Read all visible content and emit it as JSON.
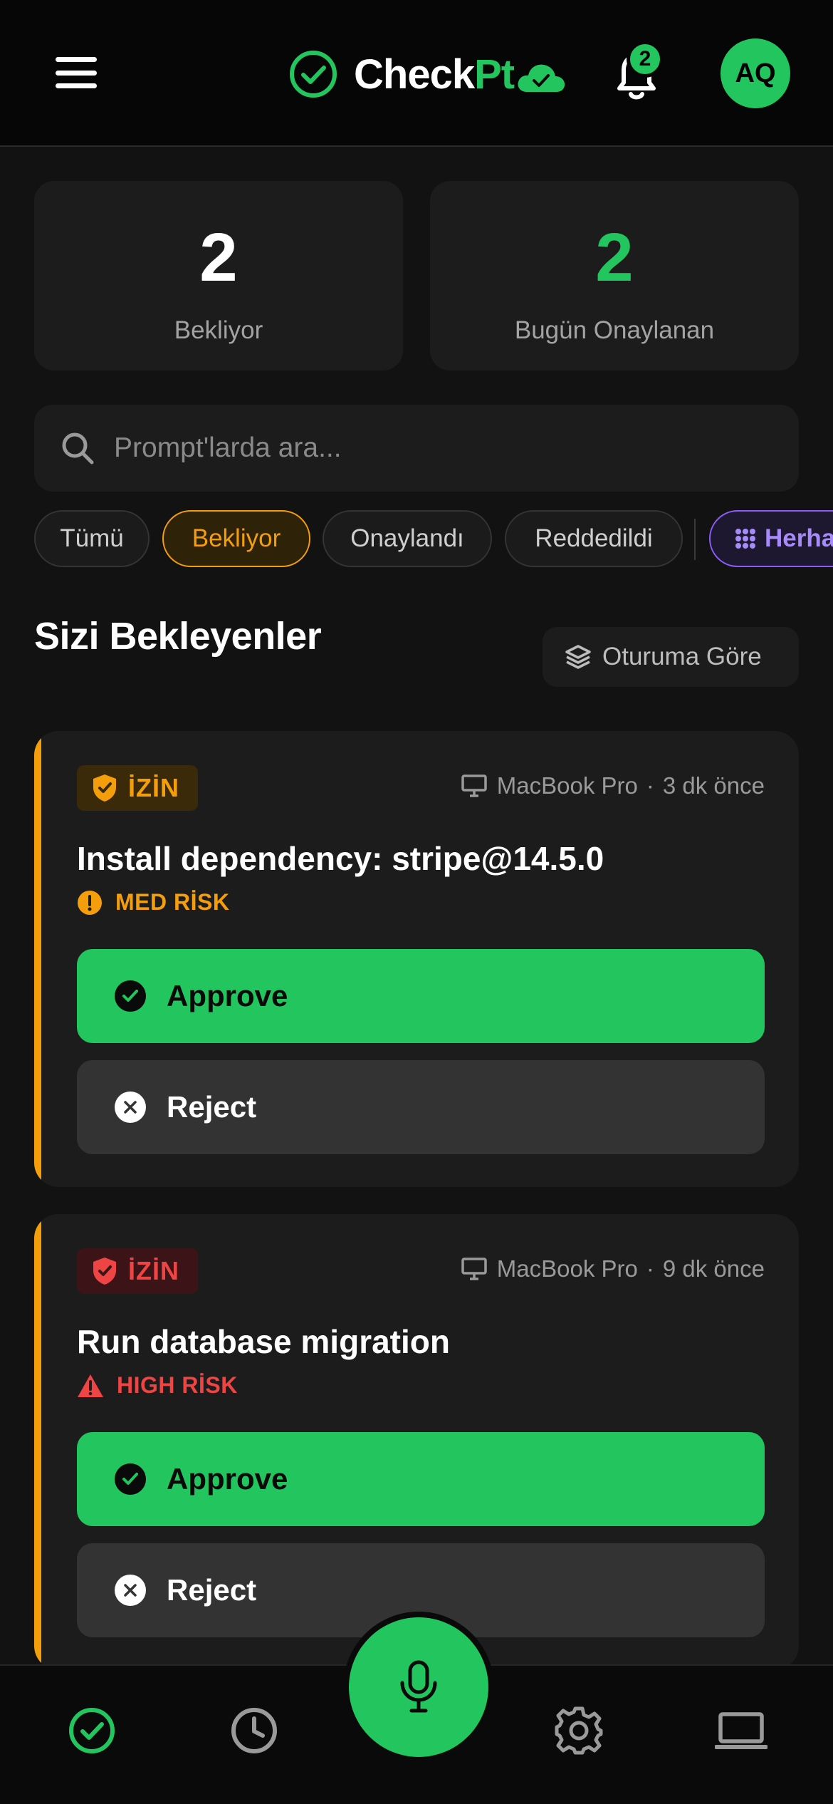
{
  "header": {
    "logo_check": "Check",
    "logo_pt": "Pt",
    "notification_count": "2",
    "avatar_initials": "AQ"
  },
  "stats": {
    "pending_count": "2",
    "pending_label": "Bekliyor",
    "approved_today_count": "2",
    "approved_today_label": "Bugün Onaylanan"
  },
  "search": {
    "placeholder": "Prompt'larda ara..."
  },
  "filters": {
    "all": "Tümü",
    "pending": "Bekliyor",
    "approved": "Onaylandı",
    "rejected": "Reddedildi",
    "any": "Herhangi"
  },
  "section": {
    "title": "Sizi Bekleyenler",
    "group_button": "Oturuma Göre"
  },
  "cards": [
    {
      "tag": "İZİN",
      "device": "MacBook Pro",
      "time": "3 dk önce",
      "title": "Install dependency: stripe@14.5.0",
      "risk": "MED RİSK",
      "approve": "Approve",
      "reject": "Reject"
    },
    {
      "tag": "İZİN",
      "device": "MacBook Pro",
      "time": "9 dk önce",
      "title": "Run database migration",
      "risk": "HIGH RİSK",
      "approve": "Approve",
      "reject": "Reject"
    }
  ],
  "colors": {
    "accent_green": "#22c55e",
    "warning_orange": "#f59e0b",
    "danger_red": "#ef4444",
    "purple": "#8b5cf6",
    "background": "#121212"
  },
  "icons": {
    "menu": "hamburger-icon",
    "logo": "check-circle-icon",
    "logo_badge": "cloud-check-icon",
    "notifications": "bell-icon",
    "search": "search-icon",
    "filter_any": "grid-icon",
    "group": "layers-icon",
    "tag_med": "shield-icon",
    "tag_high": "shield-icon",
    "device": "monitor-icon",
    "risk_med": "alert-circle-icon",
    "risk_high": "alert-triangle-icon",
    "approve": "check-circle-icon",
    "reject": "x-circle-icon",
    "tab_approvals": "check-circle-icon",
    "tab_history": "clock-icon",
    "tab_voice": "microphone-icon",
    "tab_settings": "gear-icon",
    "tab_devices": "laptop-icon"
  }
}
